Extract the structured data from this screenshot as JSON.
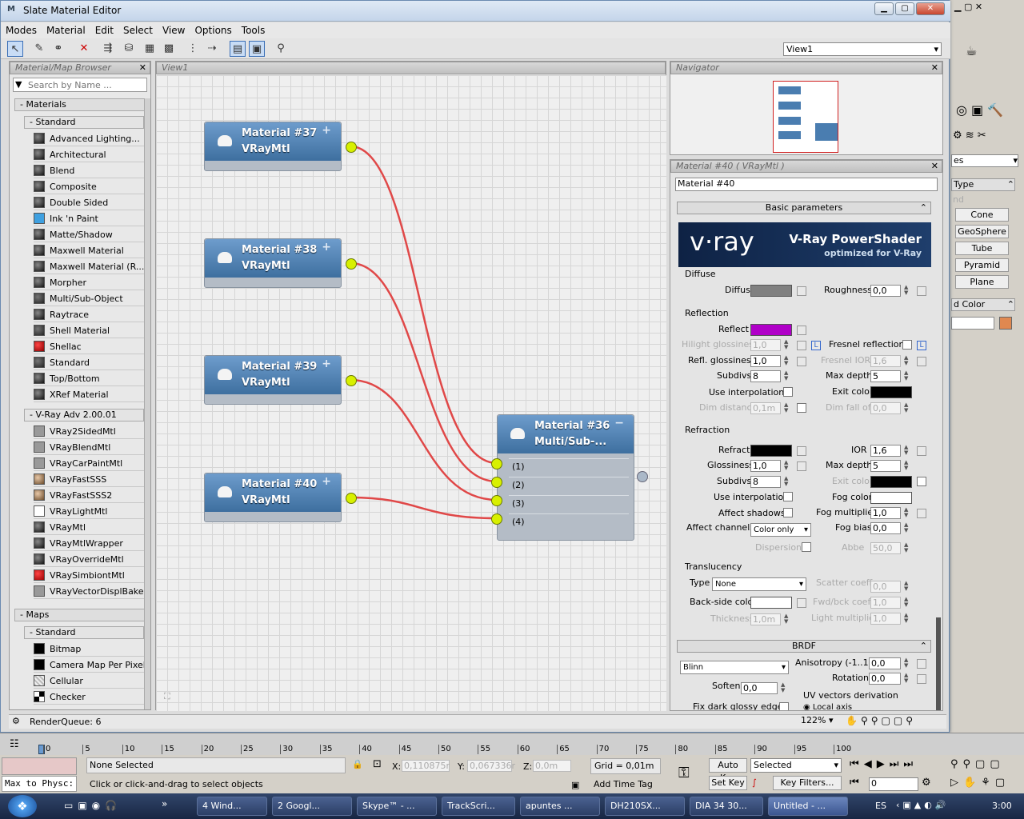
{
  "window": {
    "title": "Slate Material Editor"
  },
  "menu": [
    "Modes",
    "Material",
    "Edit",
    "Select",
    "View",
    "Options",
    "Tools"
  ],
  "view_dropdown": "View1",
  "browser": {
    "title": "Material/Map Browser",
    "search_placeholder": "Search by Name ...",
    "materials_label": "- Materials",
    "standard_label": "- Standard",
    "standard_items": [
      "Advanced Lighting...",
      "Architectural",
      "Blend",
      "Composite",
      "Double Sided",
      "Ink 'n Paint",
      "Matte/Shadow",
      "Maxwell Material",
      "Maxwell Material (R...",
      "Morpher",
      "Multi/Sub-Object",
      "Raytrace",
      "Shell Material",
      "Shellac",
      "Standard",
      "Top/Bottom",
      "XRef Material"
    ],
    "vray_label": "- V-Ray Adv 2.00.01",
    "vray_items": [
      "VRay2SidedMtl",
      "VRayBlendMtl",
      "VRayCarPaintMtl",
      "VRayFastSSS",
      "VRayFastSSS2",
      "VRayLightMtl",
      "VRayMtl",
      "VRayMtlWrapper",
      "VRayOverrideMtl",
      "VRaySimbiontMtl",
      "VRayVectorDisplBake"
    ],
    "maps_label": "- Maps",
    "maps_standard_label": "- Standard",
    "maps_items": [
      "Bitmap",
      "Camera Map Per Pixel",
      "Cellular",
      "Checker"
    ]
  },
  "view": {
    "tab": "View1",
    "nodes": [
      {
        "name": "Material #37",
        "type": "VRayMtl"
      },
      {
        "name": "Material #38",
        "type": "VRayMtl"
      },
      {
        "name": "Material #39",
        "type": "VRayMtl"
      },
      {
        "name": "Material #40",
        "type": "VRayMtl"
      }
    ],
    "multi": {
      "name": "Material #36",
      "type": "Multi/Sub-...",
      "slots": [
        "(1)",
        "(2)",
        "(3)",
        "(4)"
      ]
    }
  },
  "navigator": {
    "title": "Navigator"
  },
  "params": {
    "title": "Material #40  ( VRayMtl )",
    "name_value": "Material #40",
    "basic_rollout": "Basic parameters",
    "banner_logo": "v·ray",
    "banner_title": "V-Ray PowerShader",
    "banner_sub": "optimized for V-Ray",
    "diffuse_group": "Diffuse",
    "diffuse": "Diffuse",
    "roughness": "Roughness",
    "roughness_val": "0,0",
    "reflection_group": "Reflection",
    "reflect": "Reflect",
    "hilight": "Hilight glossiness",
    "hilight_val": "1,0",
    "fresnel": "Fresnel reflections",
    "refl_gloss": "Refl. glossiness",
    "refl_gloss_val": "1,0",
    "fresnel_ior": "Fresnel IOR",
    "fresnel_ior_val": "1,6",
    "subdivs": "Subdivs",
    "subdivs_val": "8",
    "max_depth": "Max depth",
    "max_depth_val": "5",
    "use_interp": "Use interpolation",
    "exit_color": "Exit color",
    "dim_distance": "Dim distance",
    "dim_distance_val": "0,1m",
    "dim_falloff": "Dim fall off",
    "dim_falloff_val": "0,0",
    "refraction_group": "Refraction",
    "refract": "Refract",
    "ior": "IOR",
    "ior_val": "1,6",
    "glossiness": "Glossiness",
    "glossiness_val": "1,0",
    "r_max_depth": "Max depth",
    "r_max_depth_val": "5",
    "r_subdivs": "Subdivs",
    "r_subdivs_val": "8",
    "r_exit_color": "Exit color",
    "r_use_interp": "Use interpolation",
    "fog_color": "Fog color",
    "affect_shadows": "Affect shadows",
    "fog_mult": "Fog multiplier",
    "fog_mult_val": "1,0",
    "affect_channels": "Affect channels",
    "affect_channels_val": "Color only",
    "fog_bias": "Fog bias",
    "fog_bias_val": "0,0",
    "dispersion": "Dispersion",
    "abbe": "Abbe",
    "abbe_val": "50,0",
    "translucency_group": "Translucency",
    "type": "Type",
    "type_val": "None",
    "scatter": "Scatter coeff",
    "scatter_val": "0,0",
    "backside": "Back-side color",
    "fwd_bck": "Fwd/bck coeff",
    "fwd_bck_val": "1,0",
    "thickness": "Thickness",
    "thickness_val": "1,0m",
    "light_mult": "Light multiplier",
    "light_mult_val": "1,0",
    "brdf_rollout": "BRDF",
    "brdf_type": "Blinn",
    "anisotropy": "Anisotropy (-1..1)",
    "anisotropy_val": "0,0",
    "rotation": "Rotation",
    "rotation_val": "0,0",
    "soften": "Soften",
    "soften_val": "0,0",
    "uv_vectors": "UV vectors derivation",
    "fix_dark": "Fix dark glossy edges",
    "local_axis": "Local axis",
    "colors": {
      "diffuse": "#808080",
      "reflect": "#b000c8",
      "exit": "#000000",
      "refract": "#000000",
      "fog": "#ffffff",
      "backside": "#ffffff"
    }
  },
  "status": {
    "render_queue": "RenderQueue: 6",
    "zoom": "122%"
  },
  "right_panel": {
    "dropdown": "es",
    "type_label": "Type",
    "nd_label": "nd",
    "buttons": [
      "Cone",
      "GeoSphere",
      "Tube",
      "Pyramid",
      "Plane"
    ],
    "color_label": "d Color"
  },
  "timeline": {
    "ticks": [
      "0",
      "5",
      "10",
      "15",
      "20",
      "25",
      "30",
      "35",
      "40",
      "45",
      "50",
      "55",
      "60",
      "65",
      "70",
      "75",
      "80",
      "85",
      "90",
      "95",
      "100"
    ]
  },
  "bottom": {
    "none_selected": "None Selected",
    "hint": "Click or click-and-drag to select objects",
    "script": "Max to Physc:",
    "x_label": "X:",
    "x_val": "0,110875r",
    "y_label": "Y:",
    "y_val": "0,067336r",
    "z_label": "Z:",
    "z_val": "0,0m",
    "grid": "Grid = 0,01m",
    "add_time_tag": "Add Time Tag",
    "auto_key": "Auto Key",
    "selected": "Selected",
    "set_key": "Set Key",
    "key_filters": "Key Filters...",
    "frame": "0"
  },
  "taskbar": {
    "items": [
      "4 Wind...",
      "2 Googl...",
      "Skype™ - ...",
      "TrackScri...",
      "apuntes ...",
      "DH210SX...",
      "DIA 34 30...",
      "Untitled - ..."
    ],
    "lang": "ES",
    "clock": "3:00"
  }
}
